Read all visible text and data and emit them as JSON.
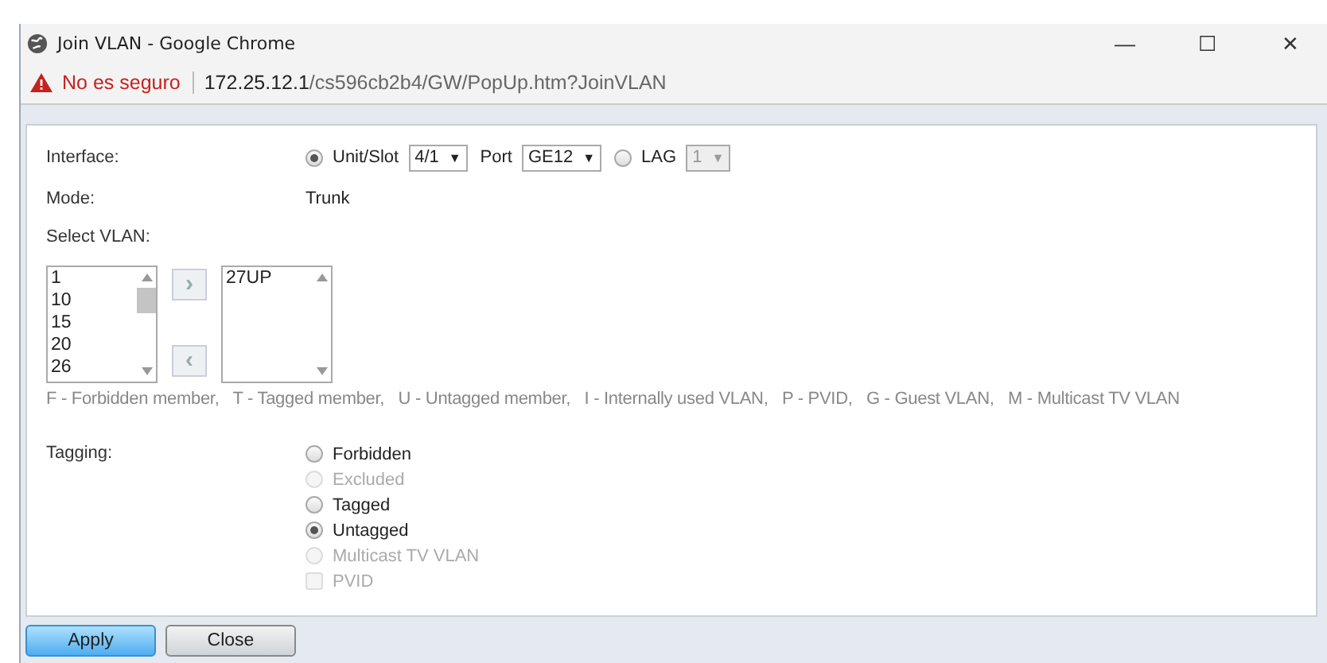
{
  "window": {
    "title": "Join VLAN - Google Chrome",
    "controls": [
      "—",
      "☐",
      "✕"
    ]
  },
  "address_bar": {
    "security": "No es seguro",
    "url_host": "172.25.12.1",
    "url_path": "/cs596cb2b4/GW/PopUp.htm?JoinVLAN"
  },
  "interface": {
    "label": "Interface:",
    "options": [
      {
        "kind": "unit",
        "label": "Unit/Slot",
        "selected": true,
        "unit": "4/1",
        "port_label": "Port",
        "port": "GE12",
        "caret": "▼"
      },
      {
        "kind": "lag",
        "label": "LAG",
        "selected": false,
        "value": "1",
        "caret": "▼",
        "disabled": true
      }
    ]
  },
  "mode": {
    "label": "Mode:",
    "value": "Trunk"
  },
  "select_vlan": {
    "label": "Select VLAN:",
    "available": [
      "1",
      "10",
      "15",
      "20",
      "26"
    ],
    "add_button": "›",
    "remove_button": "‹",
    "selected_list": [
      "27UP"
    ]
  },
  "legend": "F - Forbidden member,   T - Tagged member,   U - Untagged member,   I - Internally used VLAN,   P - PVID,   G - Guest VLAN,   M - Multicast TV VLAN",
  "tagging": {
    "label": "Tagging:",
    "options": [
      {
        "kind": "radio",
        "label": "Forbidden",
        "selected": false,
        "disabled": false
      },
      {
        "kind": "radio",
        "label": "Excluded",
        "selected": false,
        "disabled": true
      },
      {
        "kind": "radio",
        "label": "Tagged",
        "selected": false,
        "disabled": false
      },
      {
        "kind": "radio",
        "label": "Untagged",
        "selected": true,
        "disabled": false
      },
      {
        "kind": "radio",
        "label": "Multicast TV VLAN",
        "selected": false,
        "disabled": true
      },
      {
        "kind": "checkbox",
        "label": "PVID",
        "selected": false,
        "disabled": true
      }
    ]
  },
  "buttons": [
    {
      "label": "Apply",
      "primary": true
    },
    {
      "label": "Close",
      "primary": false
    }
  ]
}
